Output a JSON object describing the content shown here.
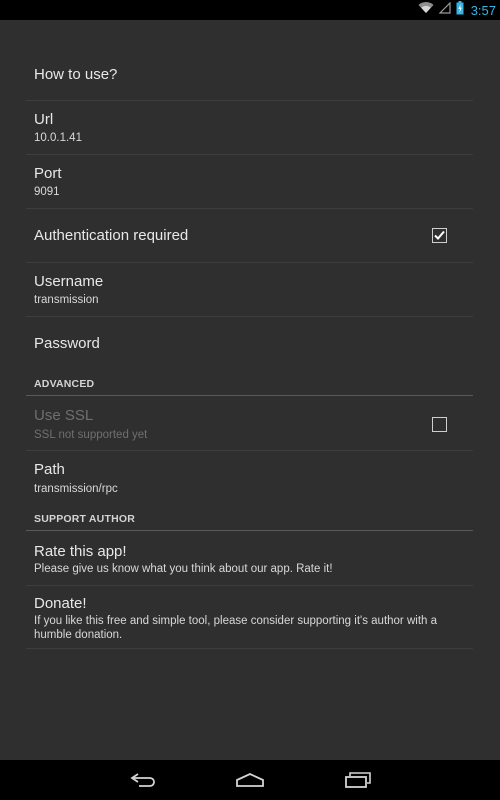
{
  "status_bar": {
    "time": "3:57",
    "icons": [
      "wifi-icon",
      "signal-icon",
      "battery-icon"
    ],
    "time_color": "#33b5e5"
  },
  "prefs": {
    "how_to_use": {
      "title": "How to use?"
    },
    "url": {
      "title": "Url",
      "summary": "10.0.1.41"
    },
    "port": {
      "title": "Port",
      "summary": "9091"
    },
    "auth": {
      "title": "Authentication required",
      "checked": true
    },
    "username": {
      "title": "Username",
      "summary": "transmission"
    },
    "password": {
      "title": "Password"
    }
  },
  "advanced": {
    "header": "ADVANCED",
    "use_ssl": {
      "title": "Use SSL",
      "summary": "SSL not supported yet",
      "checked": false,
      "enabled": false
    },
    "path": {
      "title": "Path",
      "summary": "transmission/rpc"
    }
  },
  "support": {
    "header": "SUPPORT AUTHOR",
    "rate": {
      "title": "Rate this app!",
      "summary": "Please give us know what you think about our app. Rate it!"
    },
    "donate": {
      "title": "Donate!",
      "summary": "If you like this free and simple tool, please consider supporting it's author with a humble donation."
    }
  },
  "nav_bar": {
    "buttons": [
      "back-icon",
      "home-icon",
      "recent-apps-icon"
    ]
  },
  "colors": {
    "background": "#2f2f2f",
    "divider": "#3d3d3d",
    "accent": "#33b5e5"
  }
}
